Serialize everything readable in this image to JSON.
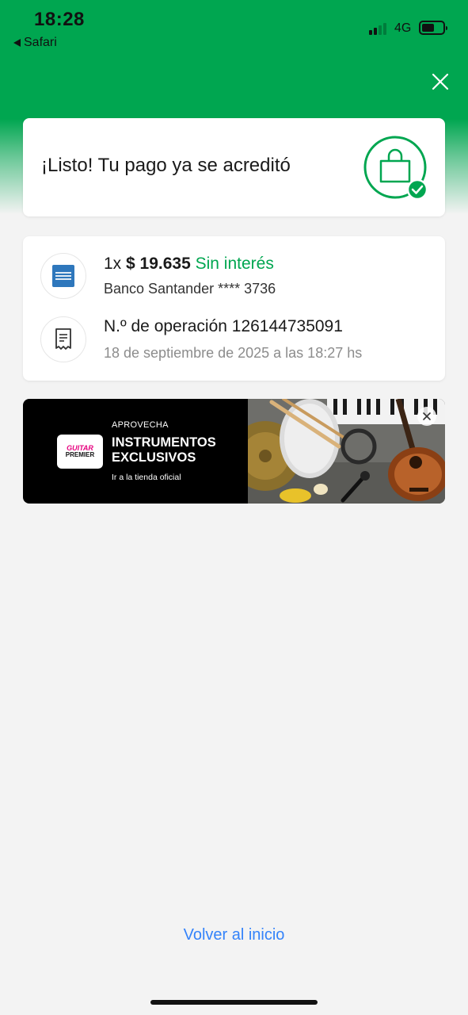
{
  "status_bar": {
    "time": "18:28",
    "back_app": "Safari",
    "network": "4G",
    "battery_level": 0.58,
    "signal_bars_active": 2
  },
  "header": {
    "close_icon": "close-icon"
  },
  "success_card": {
    "title": "¡Listo! Tu pago ya se acreditó",
    "icon": "shopping-bag-check-icon"
  },
  "payment": {
    "installments": "1x",
    "amount": "$ 19.635",
    "interest_label": "Sin interés",
    "bank": "Banco Santander **** 3736",
    "card_icon": "amex-card-icon",
    "operation_label": "N.º de operación 126144735091",
    "date": "18 de septiembre de 2025 a las 18:27 hs",
    "receipt_icon": "receipt-icon"
  },
  "banner": {
    "logo_text_1": "GUITAR",
    "logo_text_2": "PREMIER",
    "kicker": "APROVECHA",
    "title": "INSTRUMENTOS EXCLUSIVOS",
    "link": "Ir a la tienda oficial",
    "close_icon": "close-icon"
  },
  "footer": {
    "back_home": "Volver al inicio"
  },
  "colors": {
    "brand_green": "#00a650",
    "link_blue": "#3483fa",
    "amex_blue": "#2e77bc"
  }
}
